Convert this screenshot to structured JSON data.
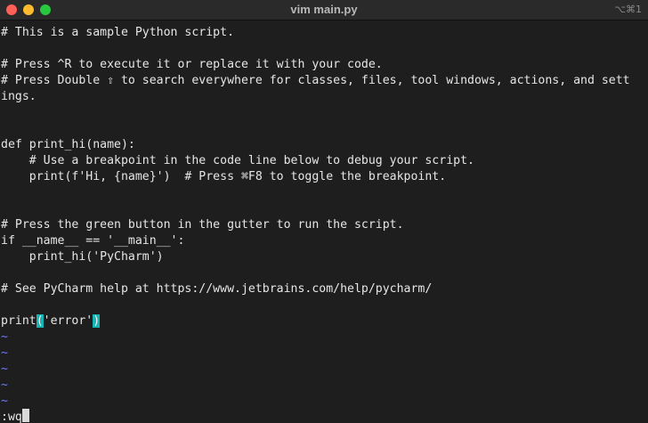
{
  "window": {
    "title": "vim main.py",
    "shortcut": "⌥⌘1"
  },
  "editor": {
    "lines": [
      "# This is a sample Python script.",
      "",
      "# Press ^R to execute it or replace it with your code.",
      "# Press Double ⇧ to search everywhere for classes, files, tool windows, actions, and sett",
      "ings.",
      "",
      "",
      "def print_hi(name):",
      "    # Use a breakpoint in the code line below to debug your script.",
      "    print(f'Hi, {name}')  # Press ⌘F8 to toggle the breakpoint.",
      "",
      "",
      "# Press the green button in the gutter to run the script.",
      "if __name__ == '__main__':",
      "    print_hi('PyCharm')",
      "",
      "# See PyCharm help at https://www.jetbrains.com/help/pycharm/",
      "",
      "print('error')"
    ],
    "highlight_line": {
      "prefix": "print",
      "open_paren": "(",
      "string": "'error'",
      "close_paren": ")"
    },
    "empty_marker": "~",
    "empty_count": 5
  },
  "commandline": {
    "text": ":wq"
  },
  "colors": {
    "background": "#1e1e1e",
    "text": "#e6e6e6",
    "tilde": "#6a7cff",
    "match_paren": "#18b3b3"
  }
}
